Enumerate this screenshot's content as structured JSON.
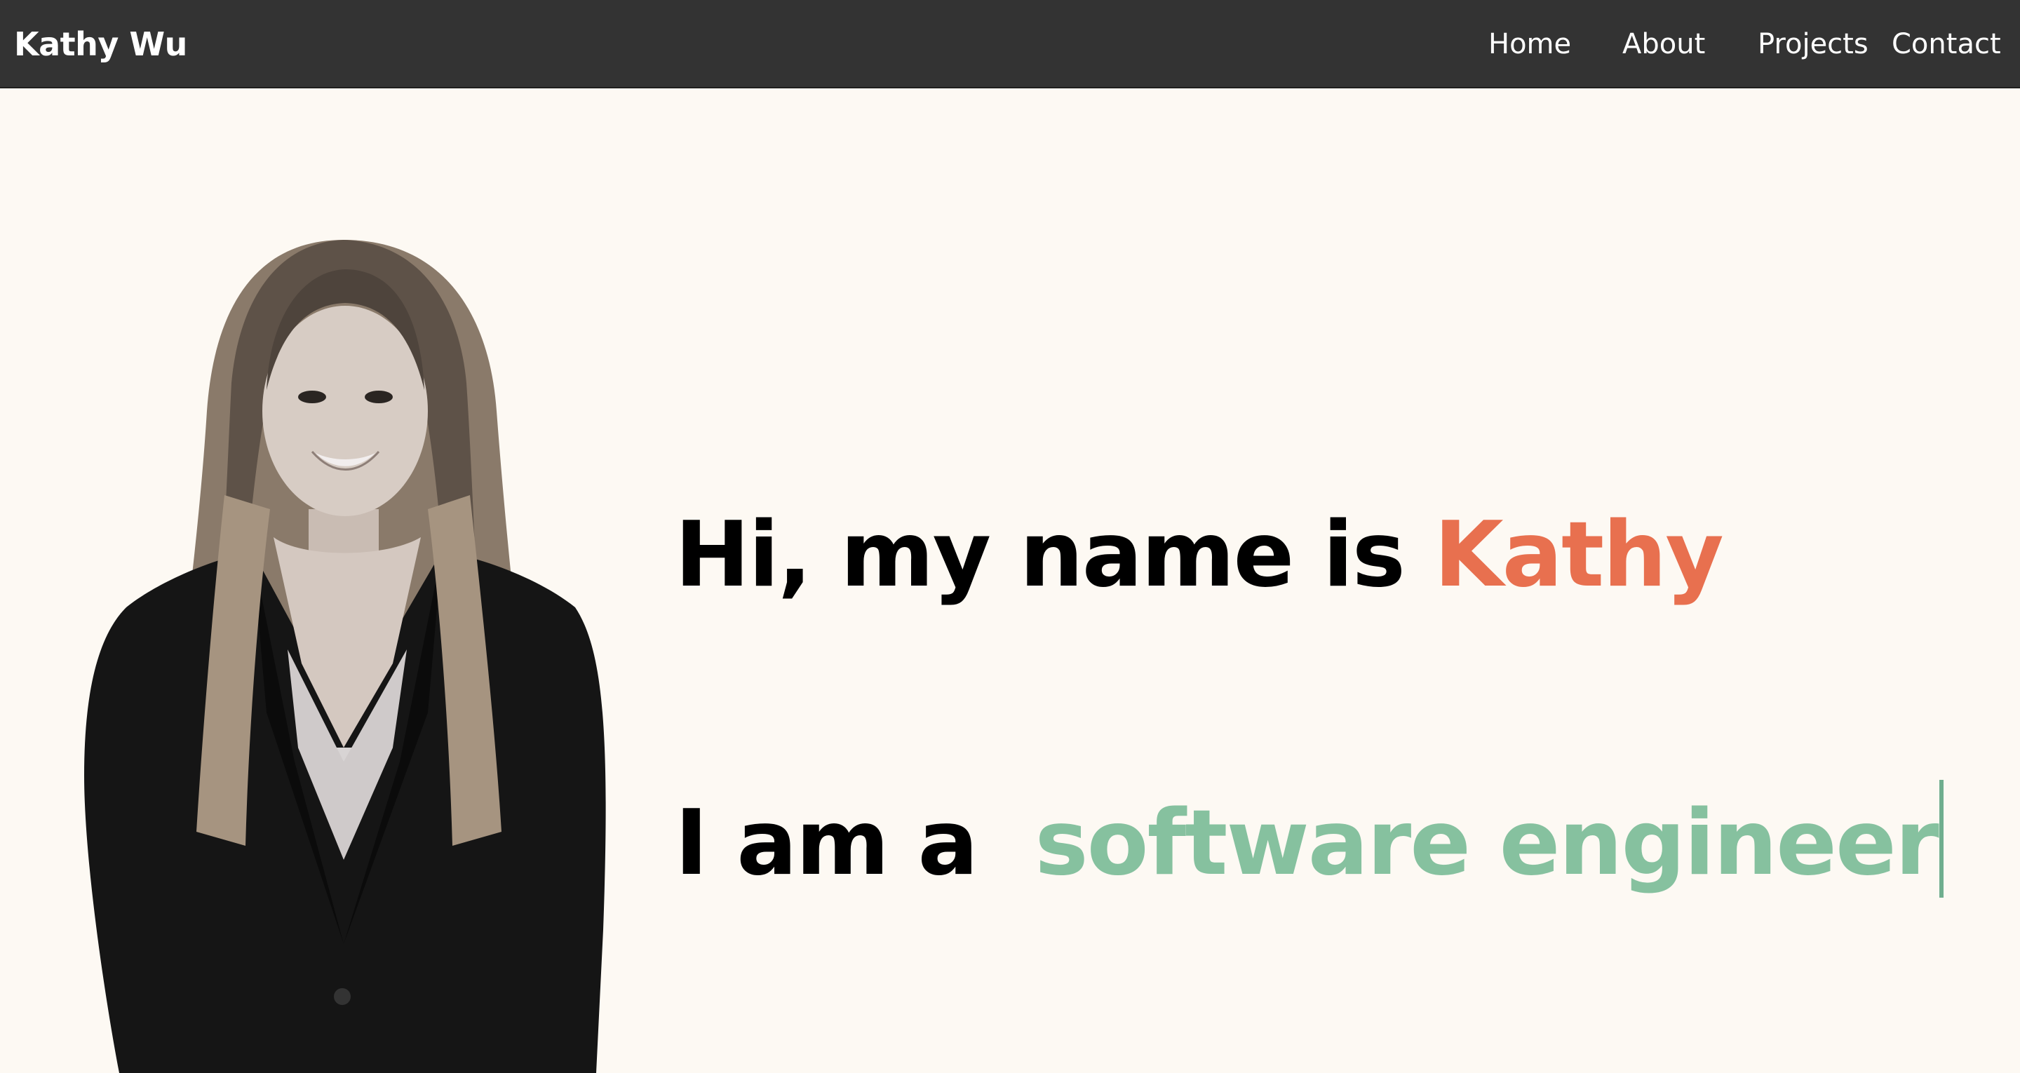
{
  "navbar": {
    "brand": "Kathy Wu",
    "links": [
      {
        "label": "Home"
      },
      {
        "label": "About"
      },
      {
        "label": "Projects"
      },
      {
        "label": "Contact"
      }
    ]
  },
  "hero": {
    "greeting_prefix": "Hi, my name is ",
    "greeting_name": "Kathy",
    "role_prefix": "I am a ",
    "role_typed": "software engineer"
  },
  "colors": {
    "navbar_bg": "#333333",
    "page_bg": "#fdf9f3",
    "name_accent": "#e8704f",
    "role_accent": "#86c19f"
  },
  "icons": {
    "portrait": "profile-photo"
  }
}
